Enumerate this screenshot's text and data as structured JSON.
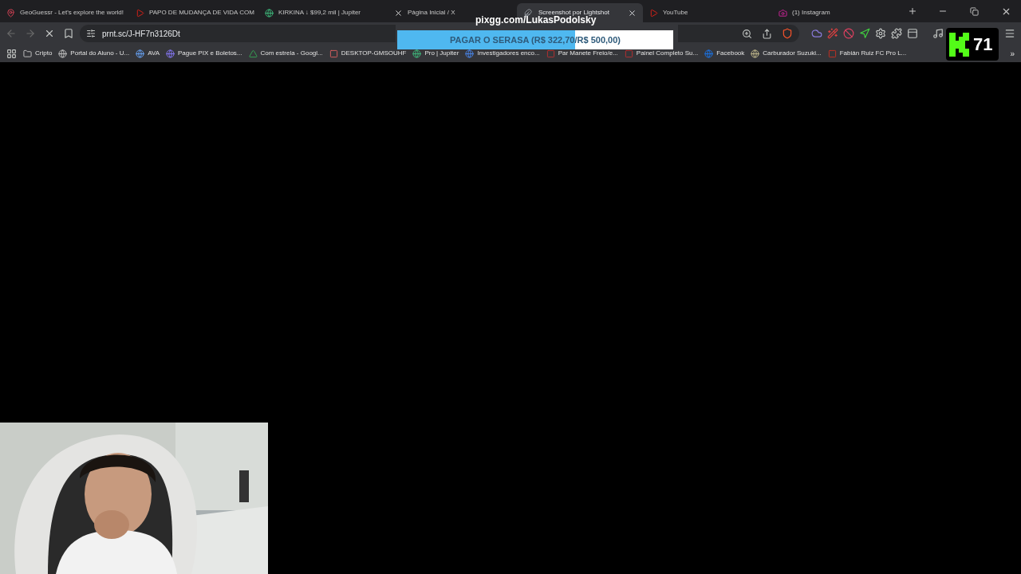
{
  "tabs": [
    {
      "label": "GeoGuessr - Let's explore the world!",
      "selected": false
    },
    {
      "label": "PAPO DE MUDANÇA DE VIDA COM",
      "selected": false
    },
    {
      "label": "KIRKINA ↓ $99,2 mil | Jupiter",
      "selected": false
    },
    {
      "label": "Página Inicial / X",
      "selected": false
    },
    {
      "label": "Screenshot por Lightshot",
      "selected": true
    },
    {
      "label": "YouTube",
      "selected": false
    },
    {
      "label": "(1) Instagram",
      "selected": false
    }
  ],
  "address": {
    "value": "prnt.sc/J-HF7n3126Dt"
  },
  "bookmarks": [
    {
      "label": "Cripto"
    },
    {
      "label": "Portal do Aluno - U..."
    },
    {
      "label": "AVA"
    },
    {
      "label": "Pague PIX e Boletos..."
    },
    {
      "label": "Com estrela - Googl..."
    },
    {
      "label": "DESKTOP-GMSOUHF"
    },
    {
      "label": "Pro | Jupiter"
    },
    {
      "label": "Investigadores enco..."
    },
    {
      "label": "Par Manete Freio/e..."
    },
    {
      "label": "Painel Completo Su..."
    },
    {
      "label": "Facebook"
    },
    {
      "label": "Carburador Suzuki..."
    },
    {
      "label": "Fabián Ruiz FC Pro L..."
    }
  ],
  "more_bookmarks": "»",
  "overlay": {
    "link": "pixgg.com/LukasPodolsky",
    "goal": "PAGAR O SERASA (R$ 322,70/R$ 500,00)",
    "level": 0.645,
    "badge": "71"
  }
}
